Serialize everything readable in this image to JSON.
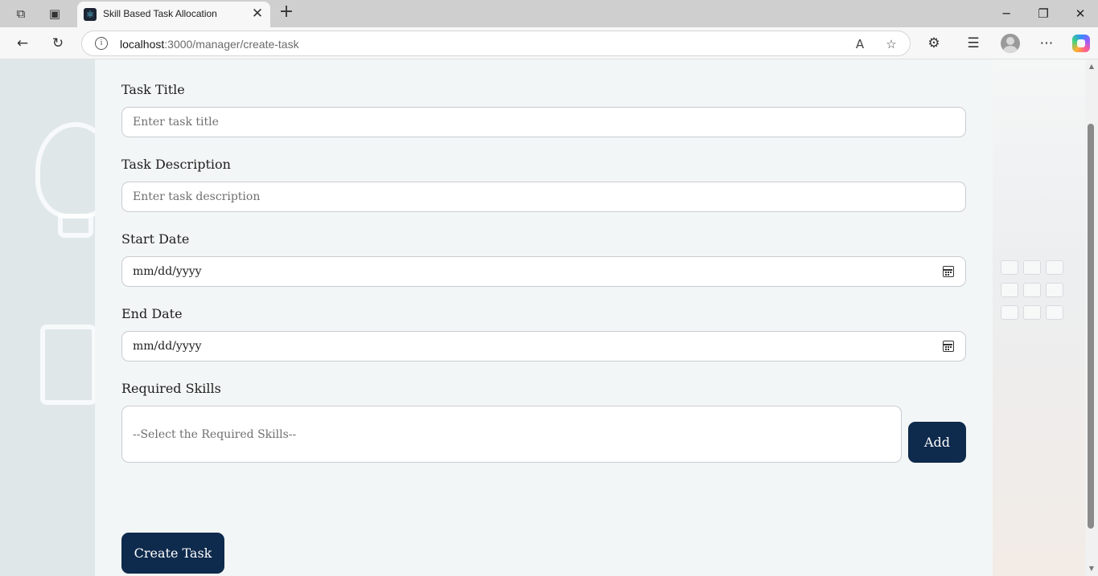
{
  "browser": {
    "tab_title": "Skill Based Task Allocation",
    "tab_close": "✕",
    "new_tab": "+",
    "address_host": "localhost",
    "address_path": ":3000/manager/create-task",
    "icons": [
      "workspaces-icon",
      "tab-actions-icon",
      "react-favicon-icon",
      "back-icon",
      "refresh-icon",
      "site-info-icon",
      "read-aloud-icon",
      "favorite-star-icon",
      "extensions-icon",
      "favorites-icon",
      "profile-icon",
      "more-icon",
      "copilot-icon",
      "minimize-icon",
      "restore-icon",
      "close-window-icon"
    ]
  },
  "form": {
    "title_label": "Task Title",
    "title_placeholder": "Enter task title",
    "description_label": "Task Description",
    "description_placeholder": "Enter task description",
    "start_label": "Start Date",
    "start_value": "mm/dd/yyyy",
    "end_label": "End Date",
    "end_value": "mm/dd/yyyy",
    "skills_label": "Required Skills",
    "skills_placeholder": "--Select the Required Skills--",
    "add_button": "Add",
    "create_button": "Create Task"
  },
  "colors": {
    "primary_button": "#0e2a4c",
    "panel_background": "#f3f6f6"
  }
}
